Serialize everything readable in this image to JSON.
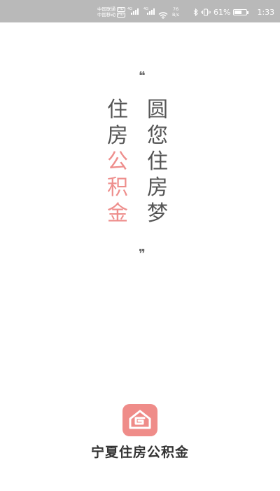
{
  "status_bar": {
    "carrier_1": "中国联通",
    "carrier_2": "中国移动",
    "hd_badge": "HD",
    "signal_gen": "4G",
    "net_speed_value": "76",
    "net_speed_unit": "B/s",
    "battery_percent": "61%",
    "battery_level": 0.61,
    "time": "1:33",
    "icons": [
      "signal-icon",
      "wifi-icon",
      "bluetooth-icon",
      "vibrate-icon",
      "battery-icon"
    ]
  },
  "slogan": {
    "left_column": {
      "gray": [
        "住",
        "房"
      ],
      "pink": [
        "公",
        "积",
        "金"
      ]
    },
    "right_column": [
      "圆",
      "您",
      "住",
      "房",
      "梦"
    ],
    "open_quote": "❝",
    "close_quote": "❞"
  },
  "app": {
    "name": "宁夏住房公积金",
    "logo_icon": "housing-fund-logo-icon"
  },
  "colors": {
    "status_bar_bg": "#b9b9b9",
    "accent_pink": "#ee8e8c",
    "text_gray": "#555555"
  }
}
